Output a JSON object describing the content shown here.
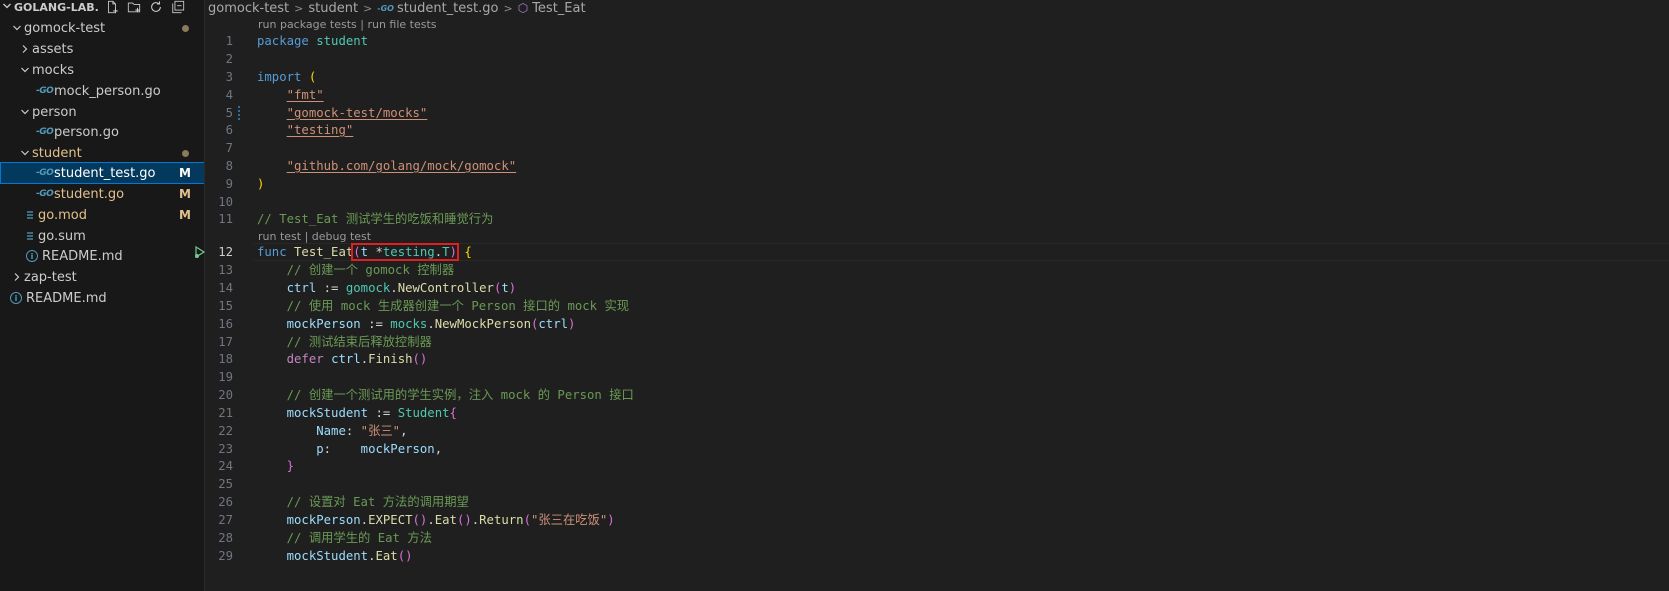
{
  "sidebar": {
    "title": "GOLANG-LAB...",
    "items": [
      {
        "label": "gomock-test",
        "type": "folder-open",
        "badge": "dot",
        "modified": false
      },
      {
        "label": "assets",
        "type": "folder-closed",
        "badge": "",
        "modified": false
      },
      {
        "label": "mocks",
        "type": "folder-open",
        "badge": "",
        "modified": false
      },
      {
        "label": "mock_person.go",
        "type": "go",
        "badge": "",
        "modified": false
      },
      {
        "label": "person",
        "type": "folder-open",
        "badge": "",
        "modified": false
      },
      {
        "label": "person.go",
        "type": "go",
        "badge": "",
        "modified": false
      },
      {
        "label": "student",
        "type": "folder-open",
        "badge": "dot",
        "modified": true
      },
      {
        "label": "student_test.go",
        "type": "go",
        "badge": "M",
        "modified": true,
        "selected": true
      },
      {
        "label": "student.go",
        "type": "go",
        "badge": "M",
        "modified": true
      },
      {
        "label": "go.mod",
        "type": "mod",
        "badge": "M",
        "modified": true
      },
      {
        "label": "go.sum",
        "type": "sum",
        "badge": "",
        "modified": false
      },
      {
        "label": "README.md",
        "type": "info",
        "badge": "",
        "modified": false
      },
      {
        "label": "zap-test",
        "type": "folder-closed",
        "badge": "",
        "modified": false
      },
      {
        "label": "README.md",
        "type": "info",
        "badge": "",
        "modified": false
      }
    ]
  },
  "breadcrumb": {
    "segments": [
      "gomock-test",
      "student",
      "student_test.go",
      "Test_Eat"
    ]
  },
  "codelens": {
    "top": "run package tests | run file tests",
    "func": "run test | debug test"
  },
  "code": {
    "lines": [
      {
        "n": "1",
        "tokens": [
          [
            "kw",
            "package"
          ],
          [
            "plain",
            " "
          ],
          [
            "pkg",
            "student"
          ]
        ]
      },
      {
        "n": "2",
        "tokens": []
      },
      {
        "n": "3",
        "tokens": [
          [
            "kw",
            "import"
          ],
          [
            "plain",
            " "
          ],
          [
            "p1",
            "("
          ]
        ]
      },
      {
        "n": "4",
        "tokens": [
          [
            "plain",
            "    "
          ],
          [
            "str",
            "\"fmt\""
          ]
        ]
      },
      {
        "n": "5",
        "tokens": [
          [
            "plain",
            "    "
          ],
          [
            "str",
            "\"gomock-test/mocks\""
          ]
        ]
      },
      {
        "n": "6",
        "tokens": [
          [
            "plain",
            "    "
          ],
          [
            "str",
            "\"testing\""
          ]
        ]
      },
      {
        "n": "7",
        "tokens": []
      },
      {
        "n": "8",
        "tokens": [
          [
            "plain",
            "    "
          ],
          [
            "str",
            "\"github.com/golang/mock/gomock\""
          ]
        ]
      },
      {
        "n": "9",
        "tokens": [
          [
            "p1",
            ")"
          ]
        ]
      },
      {
        "n": "10",
        "tokens": []
      },
      {
        "n": "11",
        "tokens": [
          [
            "cm",
            "// Test_Eat 测试学生的吃饭和睡觉行为"
          ]
        ]
      },
      {
        "n": "12",
        "tokens": [
          [
            "kw",
            "func"
          ],
          [
            "plain",
            " "
          ],
          [
            "fn",
            "Test_Eat"
          ],
          [
            "hl",
            "(t *testing.T)"
          ],
          [
            "plain",
            " "
          ],
          [
            "p1",
            "{"
          ]
        ]
      },
      {
        "n": "13",
        "tokens": [
          [
            "plain",
            "    "
          ],
          [
            "cm",
            "// 创建一个 gomock 控制器"
          ]
        ]
      },
      {
        "n": "14",
        "tokens": [
          [
            "plain",
            "    "
          ],
          [
            "var",
            "ctrl"
          ],
          [
            "plain",
            " := "
          ],
          [
            "pkg",
            "gomock"
          ],
          [
            "plain",
            "."
          ],
          [
            "fn",
            "NewController"
          ],
          [
            "p2",
            "("
          ],
          [
            "var",
            "t"
          ],
          [
            "p2",
            ")"
          ]
        ]
      },
      {
        "n": "15",
        "tokens": [
          [
            "plain",
            "    "
          ],
          [
            "cm",
            "// 使用 mock 生成器创建一个 Person 接口的 mock 实现"
          ]
        ]
      },
      {
        "n": "16",
        "tokens": [
          [
            "plain",
            "    "
          ],
          [
            "var",
            "mockPerson"
          ],
          [
            "plain",
            " := "
          ],
          [
            "pkg",
            "mocks"
          ],
          [
            "plain",
            "."
          ],
          [
            "fn",
            "NewMockPerson"
          ],
          [
            "p2",
            "("
          ],
          [
            "var",
            "ctrl"
          ],
          [
            "p2",
            ")"
          ]
        ]
      },
      {
        "n": "17",
        "tokens": [
          [
            "plain",
            "    "
          ],
          [
            "cm",
            "// 测试结束后释放控制器"
          ]
        ]
      },
      {
        "n": "18",
        "tokens": [
          [
            "plain",
            "    "
          ],
          [
            "kw2",
            "defer"
          ],
          [
            "plain",
            " "
          ],
          [
            "var",
            "ctrl"
          ],
          [
            "plain",
            "."
          ],
          [
            "fn",
            "Finish"
          ],
          [
            "p2",
            "()"
          ]
        ]
      },
      {
        "n": "19",
        "tokens": []
      },
      {
        "n": "20",
        "tokens": [
          [
            "plain",
            "    "
          ],
          [
            "cm",
            "// 创建一个测试用的学生实例，注入 mock 的 Person 接口"
          ]
        ]
      },
      {
        "n": "21",
        "tokens": [
          [
            "plain",
            "    "
          ],
          [
            "var",
            "mockStudent"
          ],
          [
            "plain",
            " := "
          ],
          [
            "typ",
            "Student"
          ],
          [
            "p2",
            "{"
          ]
        ]
      },
      {
        "n": "22",
        "tokens": [
          [
            "plain",
            "        "
          ],
          [
            "var",
            "Name"
          ],
          [
            "plain",
            ": "
          ],
          [
            "str2",
            "\"张三\""
          ],
          [
            "plain",
            ","
          ]
        ]
      },
      {
        "n": "23",
        "tokens": [
          [
            "plain",
            "        "
          ],
          [
            "var",
            "p"
          ],
          [
            "plain",
            ":    "
          ],
          [
            "var",
            "mockPerson"
          ],
          [
            "plain",
            ","
          ]
        ]
      },
      {
        "n": "24",
        "tokens": [
          [
            "plain",
            "    "
          ],
          [
            "p2",
            "}"
          ]
        ]
      },
      {
        "n": "25",
        "tokens": []
      },
      {
        "n": "26",
        "tokens": [
          [
            "plain",
            "    "
          ],
          [
            "cm",
            "// 设置对 Eat 方法的调用期望"
          ]
        ]
      },
      {
        "n": "27",
        "tokens": [
          [
            "plain",
            "    "
          ],
          [
            "var",
            "mockPerson"
          ],
          [
            "plain",
            "."
          ],
          [
            "fn",
            "EXPECT"
          ],
          [
            "p2",
            "()"
          ],
          [
            "plain",
            "."
          ],
          [
            "fn",
            "Eat"
          ],
          [
            "p2",
            "()"
          ],
          [
            "plain",
            "."
          ],
          [
            "fn",
            "Return"
          ],
          [
            "p2",
            "("
          ],
          [
            "str2",
            "\"张三在吃饭\""
          ],
          [
            "p2",
            ")"
          ]
        ]
      },
      {
        "n": "28",
        "tokens": [
          [
            "plain",
            "    "
          ],
          [
            "cm",
            "// 调用学生的 Eat 方法"
          ]
        ]
      },
      {
        "n": "29",
        "tokens": [
          [
            "plain",
            "    "
          ],
          [
            "var",
            "mockStudent"
          ],
          [
            "plain",
            "."
          ],
          [
            "fn",
            "Eat"
          ],
          [
            "p2",
            "()"
          ]
        ]
      }
    ]
  }
}
